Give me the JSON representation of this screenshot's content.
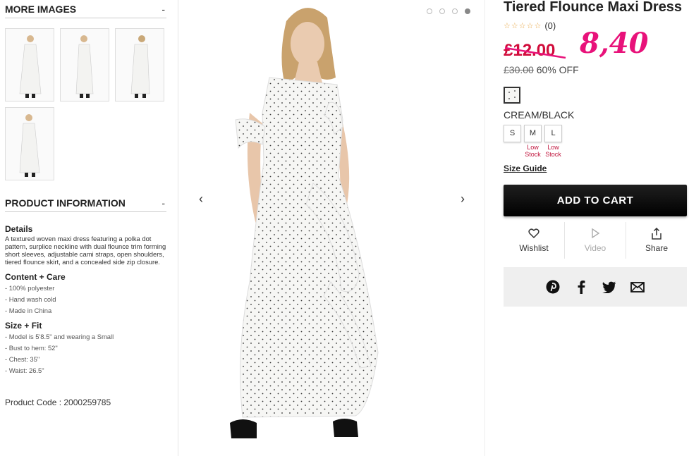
{
  "more_images": {
    "title": "MORE IMAGES",
    "toggle": "-"
  },
  "product_info": {
    "title": "PRODUCT INFORMATION",
    "toggle": "-",
    "details_heading": "Details",
    "details_text": "A textured woven maxi dress featuring a polka dot pattern, surplice neckline with dual flounce trim forming short sleeves, adjustable cami straps, open shoulders, tiered flounce skirt, and a concealed side zip closure.",
    "content_heading": "Content + Care",
    "content_items": [
      "- 100% polyester",
      "- Hand wash cold",
      "- Made in China"
    ],
    "size_heading": "Size + Fit",
    "size_items": [
      "- Model is 5'8.5\" and wearing a Small",
      "- Bust to hem: 52\"",
      "- Chest: 35\"",
      "- Waist: 26.5\""
    ],
    "product_code": "Product Code : 2000259785"
  },
  "gallery": {
    "prev": "‹",
    "next": "›",
    "total_dots": 4,
    "active_dot": 4
  },
  "product": {
    "title": "Tiered Flounce Maxi Dress",
    "stars": "☆☆☆☆☆",
    "review_count": "(0)",
    "sale_price": "£12.00",
    "handwritten_price": "8,40",
    "original_price": "£30.00",
    "discount": "60% OFF",
    "color_name": "CREAM/BLACK",
    "sizes": [
      {
        "label": "S",
        "stock": ""
      },
      {
        "label": "M",
        "stock": "Low Stock"
      },
      {
        "label": "L",
        "stock": "Low Stock"
      }
    ],
    "size_guide": "Size Guide",
    "add_to_cart": "ADD TO CART",
    "actions": {
      "wishlist": "Wishlist",
      "video": "Video",
      "share": "Share"
    }
  },
  "colors": {
    "sale": "#d10c3b",
    "handwritten": "#e8127a",
    "low_stock": "#c0143c"
  }
}
